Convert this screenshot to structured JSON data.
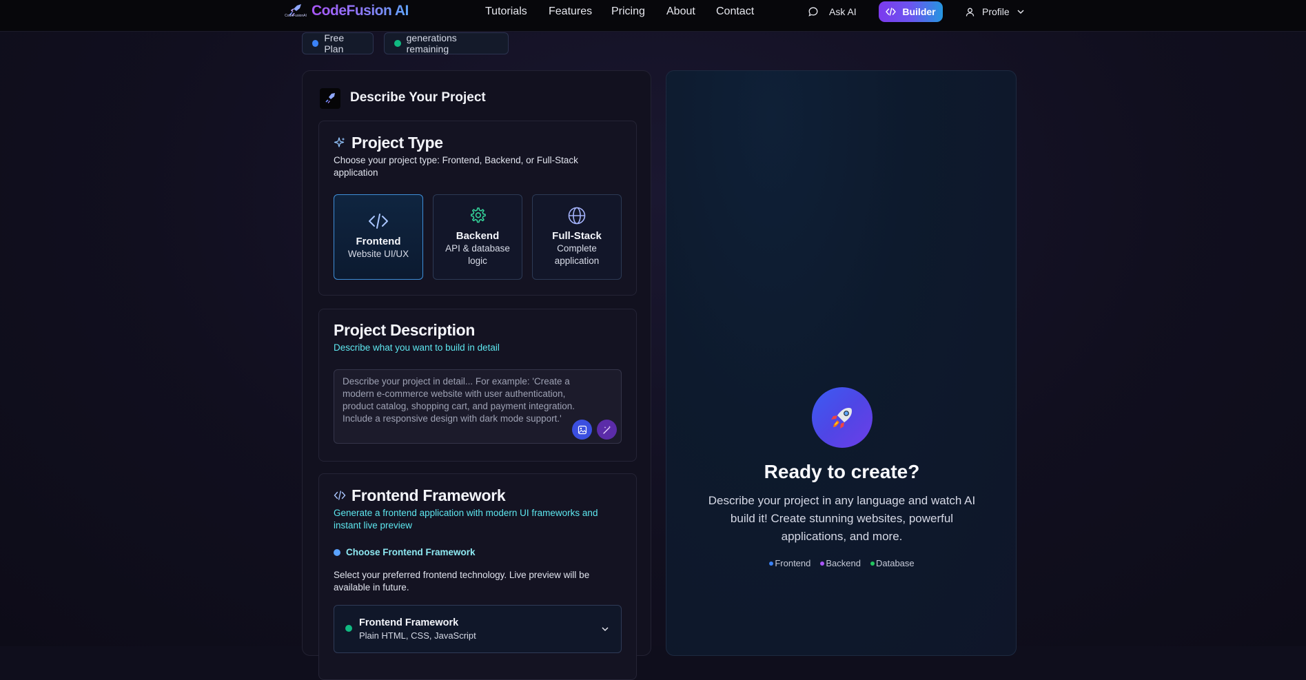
{
  "nav": {
    "logo_mini": "CodeFusionAI",
    "brand": "CodeFusion AI",
    "links": [
      "Tutorials",
      "Features",
      "Pricing",
      "About",
      "Contact"
    ],
    "ask_ai": "Ask AI",
    "builder": "Builder",
    "profile": "Profile"
  },
  "badges": {
    "plan": "Free Plan",
    "generations": "generations remaining"
  },
  "left": {
    "title": "Describe Your Project",
    "project_type": {
      "title": "Project Type",
      "subtitle": "Choose your project type: Frontend, Backend, or Full-Stack application",
      "options": [
        {
          "name": "Frontend",
          "desc": "Website UI/UX",
          "selected": true
        },
        {
          "name": "Backend",
          "desc": "API & database logic",
          "selected": false
        },
        {
          "name": "Full-Stack",
          "desc": "Complete application",
          "selected": false
        }
      ]
    },
    "description": {
      "title": "Project Description",
      "subtitle": "Describe what you want to build in detail",
      "placeholder": "Describe your project in detail... For example: 'Create a modern e-commerce website with user authentication, product catalog, shopping cart, and payment integration. Include a responsive design with dark mode support.'"
    },
    "framework": {
      "title": "Frontend Framework",
      "subtitle": "Generate a frontend application with modern UI frameworks and instant live preview",
      "choose_label": "Choose Frontend Framework",
      "help": "Select your preferred frontend technology. Live preview will be available in future.",
      "select_title": "Frontend Framework",
      "select_value": "Plain HTML, CSS, JavaScript"
    }
  },
  "right": {
    "title": "Ready to create?",
    "description": "Describe your project in any language and watch AI build it! Create stunning websites, powerful applications, and more.",
    "legend": [
      {
        "label": "Frontend",
        "color": "#3b82f6"
      },
      {
        "label": "Backend",
        "color": "#a855f7"
      },
      {
        "label": "Database",
        "color": "#22c55e"
      }
    ]
  },
  "colors": {
    "accent_blue": "#3b82f6",
    "accent_purple": "#7c3aed",
    "accent_cyan": "#5ee8f0",
    "accent_green": "#22c55e"
  }
}
